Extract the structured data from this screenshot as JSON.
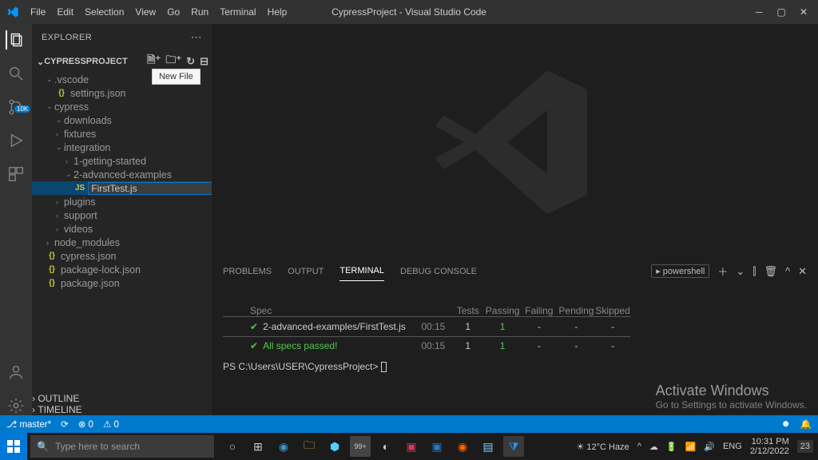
{
  "titlebar": {
    "menu": [
      "File",
      "Edit",
      "Selection",
      "View",
      "Go",
      "Run",
      "Terminal",
      "Help"
    ],
    "title": "CypressProject - Visual Studio Code"
  },
  "sidebar": {
    "header": "EXPLORER",
    "project": "CYPRESSPROJECT",
    "new_file_tooltip": "New File",
    "tree": {
      "vscode": ".vscode",
      "settings": "settings.json",
      "cypress": "cypress",
      "downloads": "downloads",
      "fixtures": "fixtures",
      "integration": "integration",
      "getting": "1-getting-started",
      "advanced": "2-advanced-examples",
      "newfile_value": "FirstTest.js",
      "plugins": "plugins",
      "support": "support",
      "videos": "videos",
      "node_modules": "node_modules",
      "cypress_json": "cypress.json",
      "pkg_lock": "package-lock.json",
      "pkg": "package.json"
    },
    "outline": "OUTLINE",
    "timeline": "TIMELINE"
  },
  "panel": {
    "tabs": {
      "problems": "PROBLEMS",
      "output": "OUTPUT",
      "terminal": "TERMINAL",
      "debug": "DEBUG CONSOLE"
    },
    "shell": "powershell",
    "headers": {
      "spec": "Spec",
      "tests": "Tests",
      "passing": "Passing",
      "failing": "Failing",
      "pending": "Pending",
      "skipped": "Skipped"
    },
    "run": {
      "name": "2-advanced-examples/FirstTest.js",
      "time": "00:15",
      "tests": "1",
      "passing": "1",
      "failing": "-",
      "pending": "-",
      "skipped": "-"
    },
    "summary": {
      "label": "All specs passed!",
      "time": "00:15",
      "tests": "1",
      "passing": "1",
      "failing": "-",
      "pending": "-",
      "skipped": "-"
    },
    "prompt": "PS C:\\Users\\USER\\CypressProject>",
    "activate": {
      "t": "Activate Windows",
      "s": "Go to Settings to activate Windows."
    }
  },
  "status": {
    "branch": "master*",
    "sync": "⟳",
    "errors": "⊗ 0",
    "warnings": "⚠ 0",
    "bell": "🔔",
    "feedback": "☻"
  },
  "taskbar": {
    "search_placeholder": "Type here to search",
    "weather": "12°C  Haze",
    "time": "10:31 PM",
    "date": "2/12/2022",
    "notif": "23"
  }
}
